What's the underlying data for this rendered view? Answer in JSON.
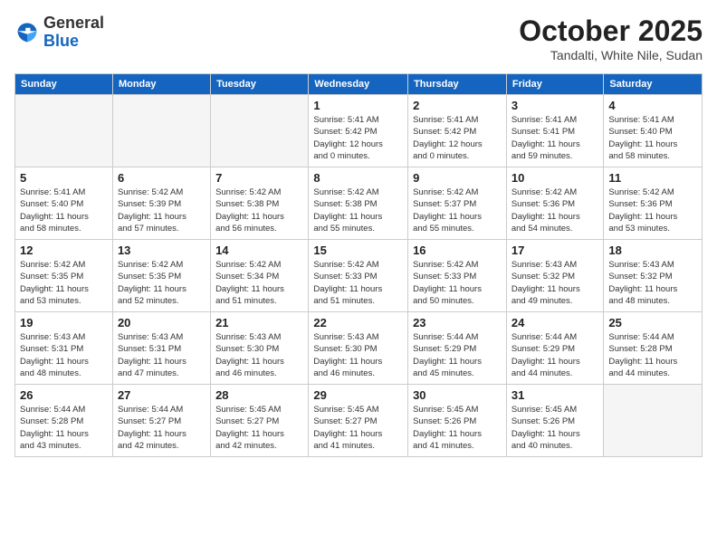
{
  "logo": {
    "general": "General",
    "blue": "Blue"
  },
  "header": {
    "month": "October 2025",
    "location": "Tandalti, White Nile, Sudan"
  },
  "weekdays": [
    "Sunday",
    "Monday",
    "Tuesday",
    "Wednesday",
    "Thursday",
    "Friday",
    "Saturday"
  ],
  "weeks": [
    [
      {
        "day": "",
        "info": ""
      },
      {
        "day": "",
        "info": ""
      },
      {
        "day": "",
        "info": ""
      },
      {
        "day": "1",
        "info": "Sunrise: 5:41 AM\nSunset: 5:42 PM\nDaylight: 12 hours\nand 0 minutes."
      },
      {
        "day": "2",
        "info": "Sunrise: 5:41 AM\nSunset: 5:42 PM\nDaylight: 12 hours\nand 0 minutes."
      },
      {
        "day": "3",
        "info": "Sunrise: 5:41 AM\nSunset: 5:41 PM\nDaylight: 11 hours\nand 59 minutes."
      },
      {
        "day": "4",
        "info": "Sunrise: 5:41 AM\nSunset: 5:40 PM\nDaylight: 11 hours\nand 58 minutes."
      }
    ],
    [
      {
        "day": "5",
        "info": "Sunrise: 5:41 AM\nSunset: 5:40 PM\nDaylight: 11 hours\nand 58 minutes."
      },
      {
        "day": "6",
        "info": "Sunrise: 5:42 AM\nSunset: 5:39 PM\nDaylight: 11 hours\nand 57 minutes."
      },
      {
        "day": "7",
        "info": "Sunrise: 5:42 AM\nSunset: 5:38 PM\nDaylight: 11 hours\nand 56 minutes."
      },
      {
        "day": "8",
        "info": "Sunrise: 5:42 AM\nSunset: 5:38 PM\nDaylight: 11 hours\nand 55 minutes."
      },
      {
        "day": "9",
        "info": "Sunrise: 5:42 AM\nSunset: 5:37 PM\nDaylight: 11 hours\nand 55 minutes."
      },
      {
        "day": "10",
        "info": "Sunrise: 5:42 AM\nSunset: 5:36 PM\nDaylight: 11 hours\nand 54 minutes."
      },
      {
        "day": "11",
        "info": "Sunrise: 5:42 AM\nSunset: 5:36 PM\nDaylight: 11 hours\nand 53 minutes."
      }
    ],
    [
      {
        "day": "12",
        "info": "Sunrise: 5:42 AM\nSunset: 5:35 PM\nDaylight: 11 hours\nand 53 minutes."
      },
      {
        "day": "13",
        "info": "Sunrise: 5:42 AM\nSunset: 5:35 PM\nDaylight: 11 hours\nand 52 minutes."
      },
      {
        "day": "14",
        "info": "Sunrise: 5:42 AM\nSunset: 5:34 PM\nDaylight: 11 hours\nand 51 minutes."
      },
      {
        "day": "15",
        "info": "Sunrise: 5:42 AM\nSunset: 5:33 PM\nDaylight: 11 hours\nand 51 minutes."
      },
      {
        "day": "16",
        "info": "Sunrise: 5:42 AM\nSunset: 5:33 PM\nDaylight: 11 hours\nand 50 minutes."
      },
      {
        "day": "17",
        "info": "Sunrise: 5:43 AM\nSunset: 5:32 PM\nDaylight: 11 hours\nand 49 minutes."
      },
      {
        "day": "18",
        "info": "Sunrise: 5:43 AM\nSunset: 5:32 PM\nDaylight: 11 hours\nand 48 minutes."
      }
    ],
    [
      {
        "day": "19",
        "info": "Sunrise: 5:43 AM\nSunset: 5:31 PM\nDaylight: 11 hours\nand 48 minutes."
      },
      {
        "day": "20",
        "info": "Sunrise: 5:43 AM\nSunset: 5:31 PM\nDaylight: 11 hours\nand 47 minutes."
      },
      {
        "day": "21",
        "info": "Sunrise: 5:43 AM\nSunset: 5:30 PM\nDaylight: 11 hours\nand 46 minutes."
      },
      {
        "day": "22",
        "info": "Sunrise: 5:43 AM\nSunset: 5:30 PM\nDaylight: 11 hours\nand 46 minutes."
      },
      {
        "day": "23",
        "info": "Sunrise: 5:44 AM\nSunset: 5:29 PM\nDaylight: 11 hours\nand 45 minutes."
      },
      {
        "day": "24",
        "info": "Sunrise: 5:44 AM\nSunset: 5:29 PM\nDaylight: 11 hours\nand 44 minutes."
      },
      {
        "day": "25",
        "info": "Sunrise: 5:44 AM\nSunset: 5:28 PM\nDaylight: 11 hours\nand 44 minutes."
      }
    ],
    [
      {
        "day": "26",
        "info": "Sunrise: 5:44 AM\nSunset: 5:28 PM\nDaylight: 11 hours\nand 43 minutes."
      },
      {
        "day": "27",
        "info": "Sunrise: 5:44 AM\nSunset: 5:27 PM\nDaylight: 11 hours\nand 42 minutes."
      },
      {
        "day": "28",
        "info": "Sunrise: 5:45 AM\nSunset: 5:27 PM\nDaylight: 11 hours\nand 42 minutes."
      },
      {
        "day": "29",
        "info": "Sunrise: 5:45 AM\nSunset: 5:27 PM\nDaylight: 11 hours\nand 41 minutes."
      },
      {
        "day": "30",
        "info": "Sunrise: 5:45 AM\nSunset: 5:26 PM\nDaylight: 11 hours\nand 41 minutes."
      },
      {
        "day": "31",
        "info": "Sunrise: 5:45 AM\nSunset: 5:26 PM\nDaylight: 11 hours\nand 40 minutes."
      },
      {
        "day": "",
        "info": ""
      }
    ]
  ]
}
